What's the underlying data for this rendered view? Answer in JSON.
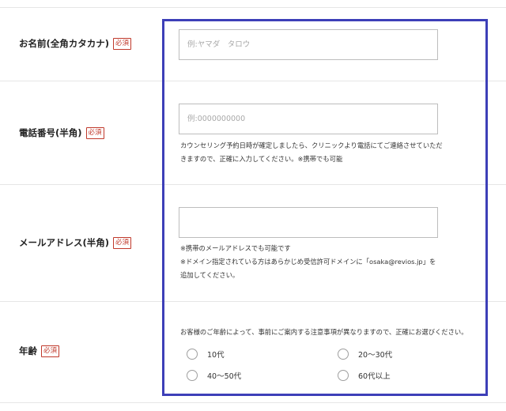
{
  "required_badge": "必須",
  "fields": {
    "name": {
      "label": "お名前(全角カタカナ)",
      "placeholder": "例:ヤマダ　タロウ"
    },
    "phone": {
      "label": "電話番号(半角)",
      "placeholder": "例:0000000000",
      "notes": [
        "カウンセリング予約日時が確定しましたら、クリニックより電話にてご連絡させていただ",
        "きますので、正確に入力してください。※携帯でも可能"
      ]
    },
    "email": {
      "label": "メールアドレス(半角)",
      "placeholder": "",
      "notes": [
        "※携帯のメールアドレスでも可能です",
        "※ドメイン指定されている方はあらかじめ受信許可ドメインに「osaka@revios.jp」を",
        "追加してください。"
      ]
    },
    "age": {
      "label": "年齢",
      "description": "お客様のご年齢によって、事前にご案内する注意事項が異なりますので、正確にお選びください。",
      "options": [
        "10代",
        "20〜30代",
        "40〜50代",
        "60代以上"
      ]
    }
  },
  "colors": {
    "highlight_border": "#3d3fb8",
    "required_badge": "#c0392b"
  }
}
